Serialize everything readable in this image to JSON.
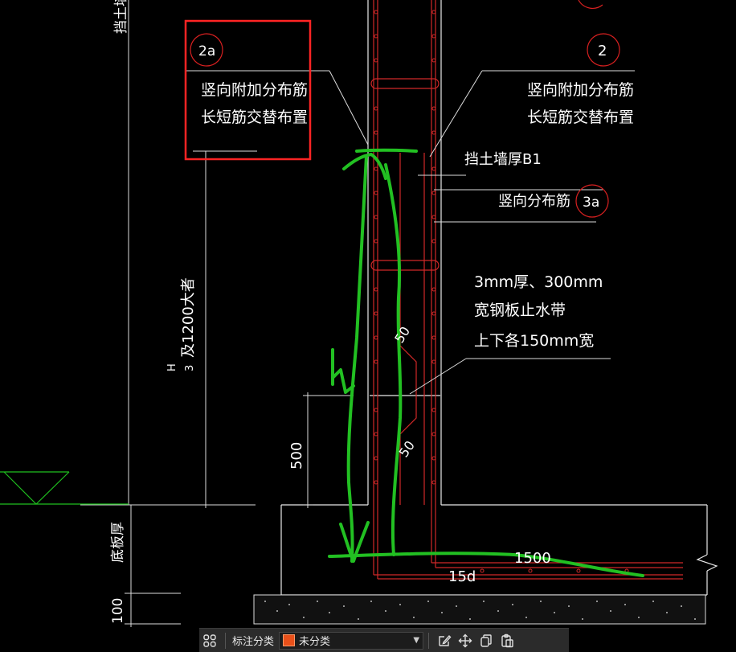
{
  "drawing": {
    "callout_2a_id": "2a",
    "callout_2a_line1": "竖向附加分布筋",
    "callout_2a_line2": "长短筋交替布置",
    "callout_2_id": "2",
    "callout_2_line1": "竖向附加分布筋",
    "callout_2_line2": "长短筋交替布置",
    "wall_thickness_label": "挡土墙厚B1",
    "vertical_rebar_label": "竖向分布筋",
    "callout_3a_id": "3a",
    "waterstop_line1": "3mm厚、300mm",
    "waterstop_line2": "宽钢板止水带",
    "waterstop_line3": "上下各150mm宽",
    "top_left_label": "挡土墙",
    "height_label_1": "H",
    "height_label_2": "3",
    "height_label_3": "及1200大者",
    "dim_500": "500",
    "dim_50_upper": "50",
    "dim_50_lower": "50",
    "dim_1500": "1500",
    "dim_15d": "15d",
    "base_thickness_label": "底板厚",
    "dim_100": "100"
  },
  "colors": {
    "background": "#000000",
    "line_white": "#ffffff",
    "rebar_red": "#e03030",
    "callout_red": "#e02020",
    "highlight_box": "#ff2020",
    "annotation_green": "#1fbf1f",
    "ground_green": "#1fbf1f"
  },
  "toolbar": {
    "layout_icon": "grid-icon",
    "category_label": "标注分类",
    "category_value": "未分类",
    "category_color": "#e8501a",
    "edit_icon": "edit-icon",
    "move_icon": "move-icon",
    "copy_icon": "copy-icon",
    "paste_icon": "paste-icon"
  }
}
